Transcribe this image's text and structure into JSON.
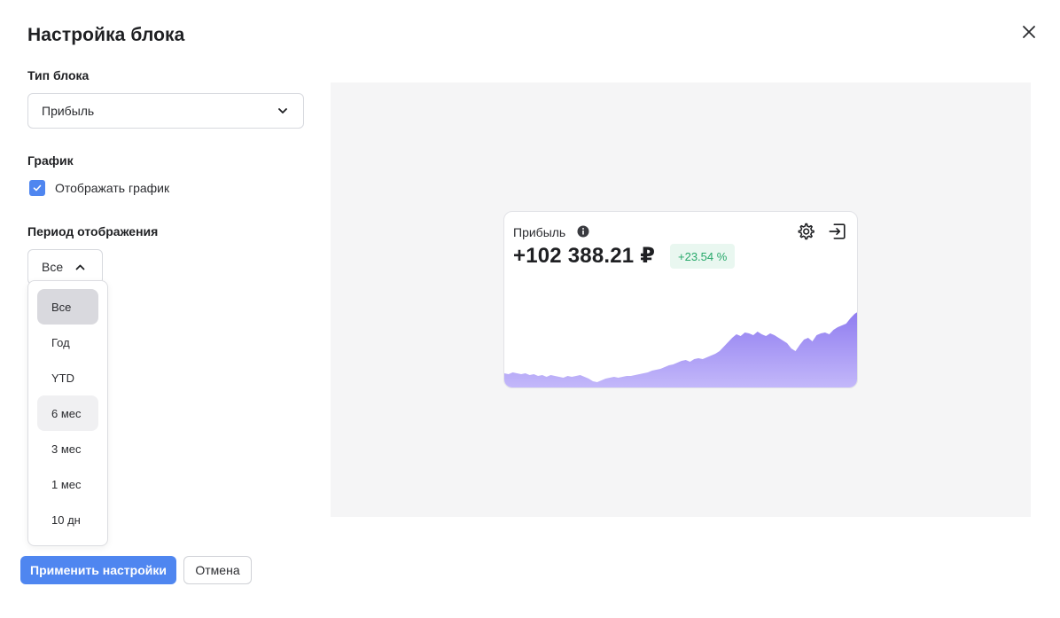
{
  "dialog": {
    "title": "Настройка блока"
  },
  "block_type": {
    "label": "Тип блока",
    "value": "Прибыль"
  },
  "chart_section": {
    "label": "График",
    "checkbox_label": "Отображать график",
    "checked": true
  },
  "period": {
    "label": "Период отображения",
    "value": "Все",
    "options": [
      "Все",
      "Год",
      "YTD",
      "6 мес",
      "3 мес",
      "1 мес",
      "10 дн"
    ],
    "selected_index": 0,
    "hover_index": 3
  },
  "buttons": {
    "apply": "Применить настройки",
    "cancel": "Отмена"
  },
  "preview_card": {
    "title": "Прибыль",
    "value": "+102 388.21 ₽",
    "change": "+23.54 %"
  },
  "colors": {
    "accent": "#4f86f0",
    "positive": "#27a86a",
    "chart_top": "#8f7cf0",
    "chart_bottom": "#c4b9fa"
  },
  "chart_data": {
    "type": "area",
    "title": "",
    "xlabel": "",
    "ylabel": "",
    "grid": false,
    "legend": "none",
    "ylim": [
      0,
      100
    ],
    "series": [
      {
        "values": [
          18,
          17,
          19,
          18,
          17,
          18,
          16,
          17,
          15,
          16,
          14,
          16,
          15,
          14,
          13,
          15,
          14,
          15,
          16,
          14,
          12,
          9,
          8,
          10,
          12,
          13,
          14,
          13,
          14,
          15,
          15,
          16,
          17,
          18,
          19,
          21,
          22,
          23,
          25,
          27,
          28,
          30,
          32,
          33,
          31,
          34,
          35,
          34,
          36,
          38,
          40,
          43,
          48,
          53,
          58,
          62,
          60,
          64,
          63,
          61,
          65,
          62,
          60,
          63,
          61,
          58,
          55,
          52,
          46,
          43,
          50,
          56,
          58,
          54,
          61,
          63,
          64,
          62,
          67,
          70,
          72,
          74,
          80,
          85,
          88
        ]
      }
    ]
  }
}
